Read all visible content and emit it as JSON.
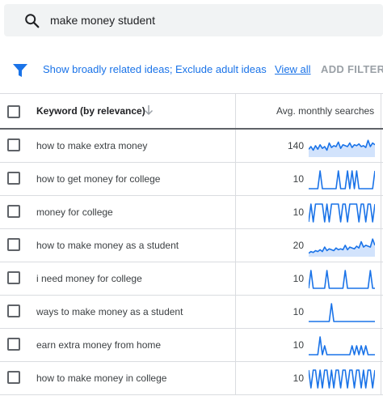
{
  "search": {
    "query": "make money student"
  },
  "filters": {
    "broadly_related": "Show broadly related ideas;",
    "exclude_adult": "Exclude adult ideas",
    "view_all": "View all",
    "add_filter": "ADD FILTER"
  },
  "table": {
    "header": {
      "keyword": "Keyword (by relevance)",
      "searches": "Avg. monthly searches"
    },
    "rows": [
      {
        "keyword": "how to make extra money",
        "volume": "140",
        "trend": [
          0.35,
          0.5,
          0.3,
          0.55,
          0.35,
          0.6,
          0.4,
          0.5,
          0.3,
          0.7,
          0.45,
          0.55,
          0.5,
          0.75,
          0.4,
          0.6,
          0.55,
          0.5,
          0.7,
          0.45,
          0.6,
          0.55,
          0.65,
          0.5,
          0.55,
          0.45,
          0.85,
          0.5,
          0.7,
          0.6
        ],
        "area": true
      },
      {
        "keyword": "how to get money for college",
        "volume": "10",
        "trend": [
          0,
          0,
          0,
          0,
          0,
          1,
          0,
          0,
          0,
          0,
          0,
          0,
          0,
          1,
          0,
          0,
          0,
          1,
          0,
          1,
          0,
          1,
          0,
          0,
          0,
          0,
          0,
          0,
          0,
          1
        ],
        "area": false
      },
      {
        "keyword": "money for college",
        "volume": "10",
        "trend": [
          0,
          1,
          0,
          1,
          1,
          1,
          1,
          0,
          1,
          0,
          1,
          1,
          1,
          1,
          0,
          1,
          1,
          0,
          1,
          1,
          1,
          1,
          0,
          1,
          1,
          0,
          1,
          1,
          0,
          1
        ],
        "area": false
      },
      {
        "keyword": "how to make money as a student",
        "volume": "20",
        "trend": [
          0.1,
          0.2,
          0.15,
          0.25,
          0.2,
          0.3,
          0.2,
          0.45,
          0.25,
          0.35,
          0.3,
          0.25,
          0.4,
          0.3,
          0.35,
          0.3,
          0.55,
          0.3,
          0.45,
          0.4,
          0.35,
          0.5,
          0.4,
          0.75,
          0.45,
          0.55,
          0.5,
          0.45,
          0.9,
          0.55
        ],
        "area": true
      },
      {
        "keyword": "i need money for college",
        "volume": "10",
        "trend": [
          0,
          1,
          0,
          0,
          0,
          0,
          0,
          0,
          1,
          0,
          0,
          0,
          0,
          0,
          0,
          0,
          1,
          0,
          0,
          0,
          0,
          0,
          0,
          0,
          0,
          0,
          0,
          1,
          0,
          0
        ],
        "area": false
      },
      {
        "keyword": "ways to make money as a student",
        "volume": "10",
        "trend": [
          0,
          0,
          0,
          0,
          0,
          0,
          0,
          0,
          0,
          0,
          1,
          0,
          0,
          0,
          0,
          0,
          0,
          0,
          0,
          0,
          0,
          0,
          0,
          0,
          0,
          0,
          0,
          0,
          0,
          0
        ],
        "area": false
      },
      {
        "keyword": "earn extra money from home",
        "volume": "10",
        "trend": [
          0,
          0,
          0,
          0,
          0,
          1,
          0,
          0.5,
          0,
          0,
          0,
          0,
          0,
          0,
          0,
          0,
          0,
          0,
          0,
          0.5,
          0,
          0.5,
          0,
          0.5,
          0,
          0.5,
          0,
          0,
          0,
          0
        ],
        "area": false
      },
      {
        "keyword": "how to make money in college",
        "volume": "10",
        "trend": [
          1,
          0,
          1,
          1,
          0,
          1,
          0,
          1,
          1,
          0,
          1,
          0,
          1,
          1,
          0,
          1,
          1,
          0,
          1,
          1,
          0,
          1,
          1,
          0,
          1,
          0,
          1,
          1,
          0,
          1
        ],
        "area": false
      }
    ]
  },
  "colors": {
    "accent": "#1a73e8",
    "spark_line": "#1a73e8",
    "spark_fill": "#d2e3fc"
  },
  "icons": {
    "search": "search-icon",
    "filter": "filter-icon",
    "sort": "arrow-down-icon",
    "checkbox": "checkbox-icon"
  }
}
